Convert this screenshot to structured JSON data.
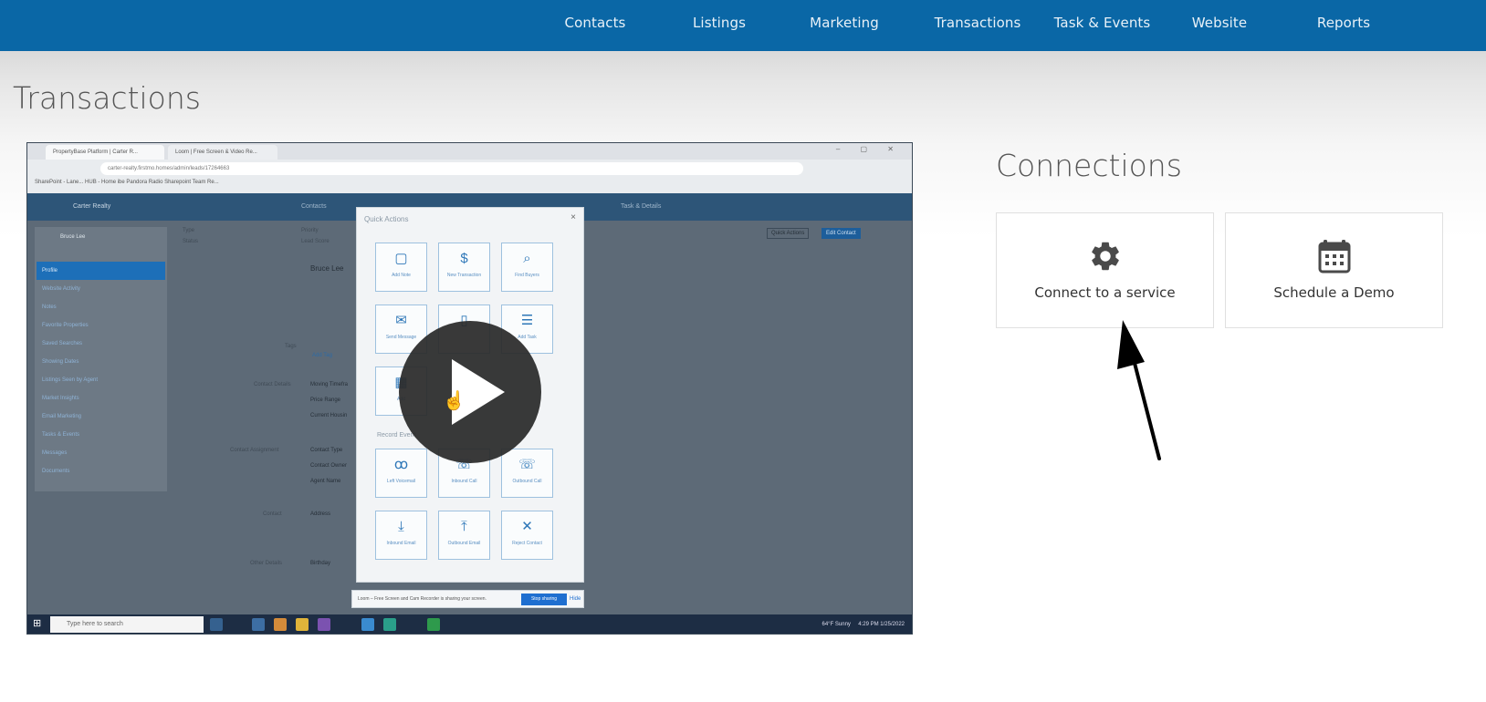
{
  "nav": {
    "items": [
      "Contacts",
      "Listings",
      "Marketing",
      "Transactions",
      "Task & Events",
      "Website",
      "Reports"
    ]
  },
  "page": {
    "title": "Transactions"
  },
  "video": {
    "browser_tabs": [
      "PropertyBase Platform | Carter R...",
      "Loom | Free Screen & Video Re..."
    ],
    "address": "carter-realty.firstmo.homes/admin/leads/17264663",
    "bookmarks": "SharePoint - Lane...   HUB - Home   ibe   Pandora Radio   Sharepoint Team Re...",
    "app_bar": {
      "brand": "Carter Realty",
      "contacts": "Contacts",
      "tasks": "Task & Details"
    },
    "contact_name": "Bruce Lee",
    "sidebar": [
      "Profile",
      "Website Activity",
      "Notes",
      "Favorite Properties",
      "Saved Searches",
      "Showing Dates",
      "Listings Seen by Agent",
      "Market Insights",
      "Email Marketing",
      "Tasks & Events",
      "Messages",
      "Documents"
    ],
    "detail_labels": {
      "type": "Type",
      "status": "Status",
      "priority": "Priority",
      "lead_score": "Lead Score",
      "name": "Bruce Lee",
      "tags": "Tags",
      "add_tag": "Add Tag",
      "contact_details": "Contact Details",
      "moving_timeframe": "Moving Timefra",
      "price_range": "Price Range",
      "current_housing": "Current Housin",
      "contact_assignment": "Contact Assignment",
      "contact_type": "Contact Type",
      "contact_owner": "Contact Owner",
      "agent_name": "Agent Name",
      "contact": "Contact",
      "address": "Address",
      "other_details": "Other Details",
      "birthday": "Birthday",
      "quick_actions_btn": "Quick Actions",
      "edit_contact_btn": "Edit Contact"
    },
    "modal": {
      "title": "Quick Actions",
      "close": "×",
      "record_event": "Record Event",
      "actions": [
        "Add Note",
        "New Transaction",
        "Find Buyers",
        "Send Message",
        "",
        "Add Task",
        "Add",
        "Left Voicemail",
        "Inbound Call",
        "Outbound Call",
        "Inbound Email",
        "Outbound Email",
        "Reject Contact"
      ]
    },
    "share_bar": {
      "text": "Loom – Free Screen and Cam Recorder is sharing your screen.",
      "stop": "Stop sharing",
      "hide": "Hide"
    },
    "taskbar": {
      "search": "Type here to search",
      "weather": "64°F Sunny",
      "time": "4:29 PM",
      "date": "1/25/2022"
    }
  },
  "connections": {
    "title": "Connections",
    "cards": [
      {
        "label": "Connect to a service",
        "icon": "gear-icon"
      },
      {
        "label": "Schedule a Demo",
        "icon": "calendar-icon"
      }
    ]
  },
  "colors": {
    "nav": "#0a67a6",
    "accent": "#1d6fb8"
  }
}
